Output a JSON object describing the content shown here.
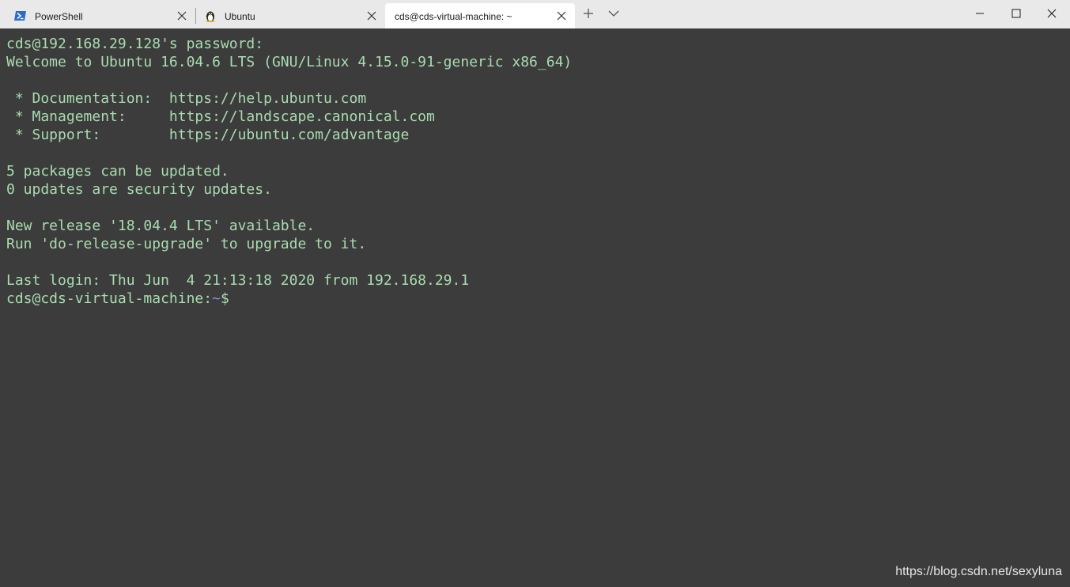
{
  "tabs": [
    {
      "label": "PowerShell",
      "icon": "powershell-icon"
    },
    {
      "label": "Ubuntu",
      "icon": "tux-penguin-icon"
    },
    {
      "label": "cds@cds-virtual-machine: ~",
      "icon": ""
    }
  ],
  "window_controls": {
    "new_tab_icon": "plus-icon",
    "dropdown_icon": "chevron-down-icon",
    "minimize_icon": "minimize-icon",
    "maximize_icon": "maximize-icon",
    "close_icon": "close-icon"
  },
  "terminal": {
    "lines": [
      "cds@192.168.29.128's password:",
      "Welcome to Ubuntu 16.04.6 LTS (GNU/Linux 4.15.0-91-generic x86_64)",
      "",
      " * Documentation:  https://help.ubuntu.com",
      " * Management:     https://landscape.canonical.com",
      " * Support:        https://ubuntu.com/advantage",
      "",
      "5 packages can be updated.",
      "0 updates are security updates.",
      "",
      "New release '18.04.4 LTS' available.",
      "Run 'do-release-upgrade' to upgrade to it.",
      "",
      "Last login: Thu Jun  4 21:13:18 2020 from 192.168.29.1"
    ],
    "prompt": {
      "user_host": "cds@cds-virtual-machine:",
      "path": "~",
      "symbol": "$"
    }
  },
  "watermark": "https://blog.csdn.net/sexyluna",
  "colors": {
    "terminal_background": "#3c3c3c",
    "terminal_text": "#a9dcb0",
    "prompt_path": "#8c8cd6",
    "tabbar_background": "#e9e9e9",
    "active_tab_background": "#ffffff"
  }
}
